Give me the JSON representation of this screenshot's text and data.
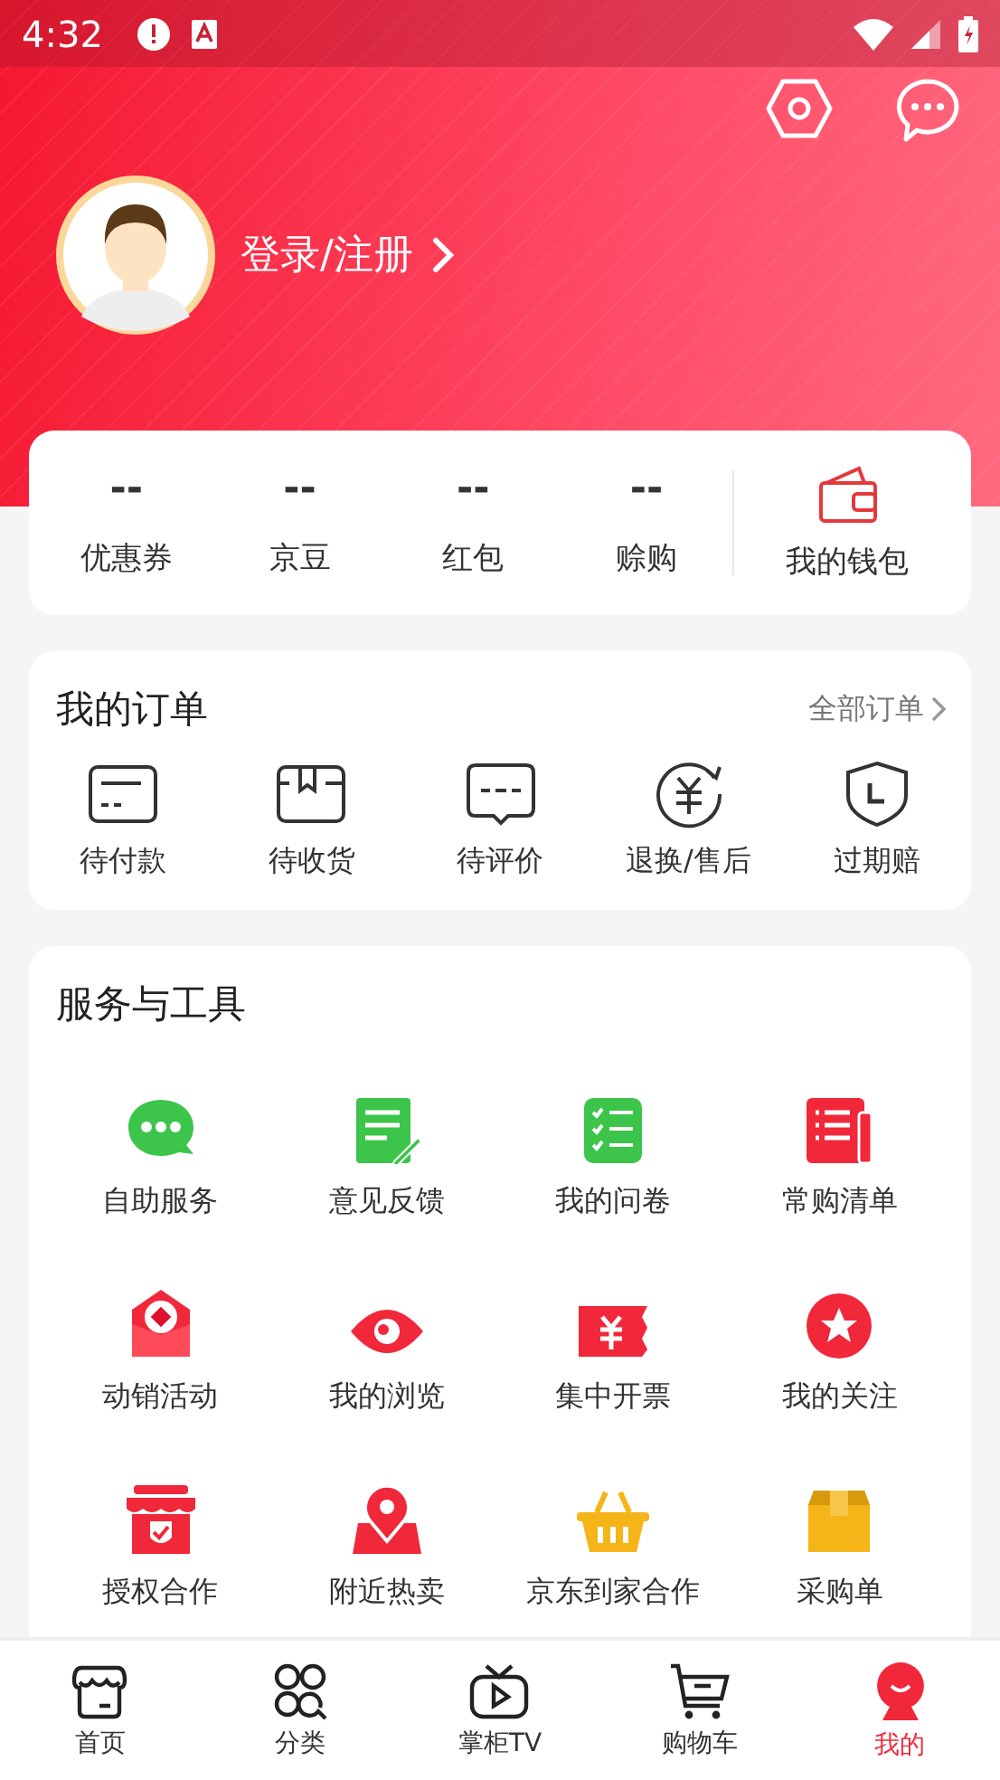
{
  "status_bar": {
    "time": "4:32"
  },
  "profile": {
    "login_label": "登录/注册"
  },
  "stats": [
    {
      "value": "--",
      "label": "优惠券"
    },
    {
      "value": "--",
      "label": "京豆"
    },
    {
      "value": "--",
      "label": "红包"
    },
    {
      "value": "--",
      "label": "赊购"
    }
  ],
  "wallet": {
    "label": "我的钱包"
  },
  "orders": {
    "title": "我的订单",
    "all_link": "全部订单",
    "items": [
      {
        "label": "待付款"
      },
      {
        "label": "待收货"
      },
      {
        "label": "待评价"
      },
      {
        "label": "退换/售后"
      },
      {
        "label": "过期赔"
      }
    ]
  },
  "services": {
    "title": "服务与工具",
    "items": [
      {
        "label": "自助服务"
      },
      {
        "label": "意见反馈"
      },
      {
        "label": "我的问卷"
      },
      {
        "label": "常购清单"
      },
      {
        "label": "动销活动"
      },
      {
        "label": "我的浏览"
      },
      {
        "label": "集中开票"
      },
      {
        "label": "我的关注"
      },
      {
        "label": "授权合作"
      },
      {
        "label": "附近热卖"
      },
      {
        "label": "京东到家合作"
      },
      {
        "label": "采购单"
      }
    ]
  },
  "tab_bar": [
    {
      "label": "首页",
      "selected": false
    },
    {
      "label": "分类",
      "selected": false
    },
    {
      "label": "掌柜TV",
      "selected": false
    },
    {
      "label": "购物车",
      "selected": false
    },
    {
      "label": "我的",
      "selected": true
    }
  ]
}
